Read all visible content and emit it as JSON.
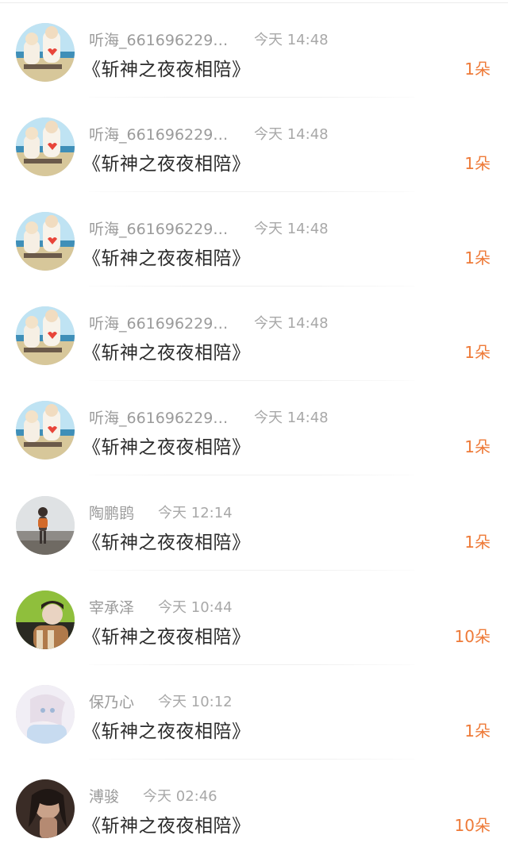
{
  "gift_title": "《斩神之夜夜相陪》",
  "rows": [
    {
      "user": "听海_661696229…",
      "time": "今天 14:48",
      "count": "1朵",
      "avatar": "couple-avatar-icon"
    },
    {
      "user": "听海_661696229…",
      "time": "今天 14:48",
      "count": "1朵",
      "avatar": "couple-avatar-icon"
    },
    {
      "user": "听海_661696229…",
      "time": "今天 14:48",
      "count": "1朵",
      "avatar": "couple-avatar-icon"
    },
    {
      "user": "听海_661696229…",
      "time": "今天 14:48",
      "count": "1朵",
      "avatar": "couple-avatar-icon"
    },
    {
      "user": "听海_661696229…",
      "time": "今天 14:48",
      "count": "1朵",
      "avatar": "couple-avatar-icon"
    },
    {
      "user": "陶鹏鹍",
      "time": "今天 12:14",
      "count": "1朵",
      "avatar": "beach-person-avatar-icon"
    },
    {
      "user": "宰承泽",
      "time": "今天 10:44",
      "count": "10朵",
      "avatar": "green-person-avatar-icon"
    },
    {
      "user": "保乃心",
      "time": "今天 10:12",
      "count": "1朵",
      "avatar": "pastel-avatar-icon"
    },
    {
      "user": "溥骏",
      "time": "今天 02:46",
      "count": "10朵",
      "avatar": "dark-portrait-avatar-icon"
    }
  ],
  "colors": {
    "count": "#ee7a38",
    "username": "#9b9b9b",
    "title": "#2b2b2b"
  }
}
